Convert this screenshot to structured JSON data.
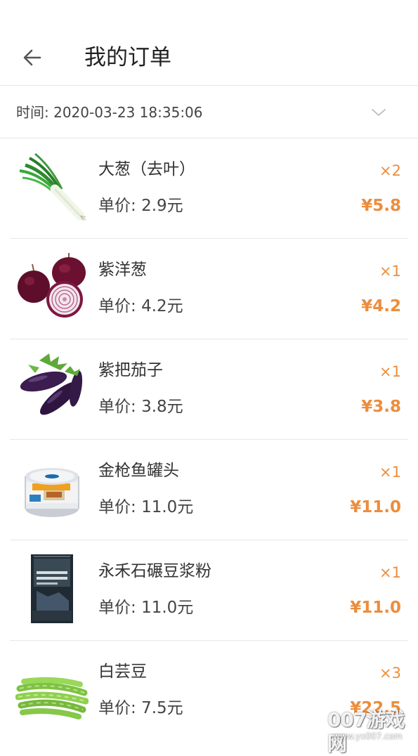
{
  "header": {
    "title": "我的订单",
    "back_icon": "arrow-left-icon"
  },
  "order": {
    "time_text": "时间: 2020-03-23 18:35:06",
    "expand_icon": "chevron-down-icon"
  },
  "price_prefix": "单价:",
  "items": [
    {
      "name": "大葱（去叶）",
      "unit_price": "2.9元",
      "qty": "×2",
      "total": "¥5.8",
      "image": "green-onion"
    },
    {
      "name": "紫洋葱",
      "unit_price": "4.2元",
      "qty": "×1",
      "total": "¥4.2",
      "image": "red-onion"
    },
    {
      "name": "紫把茄子",
      "unit_price": "3.8元",
      "qty": "×1",
      "total": "¥3.8",
      "image": "eggplant"
    },
    {
      "name": "金枪鱼罐头",
      "unit_price": "11.0元",
      "qty": "×1",
      "total": "¥11.0",
      "image": "tuna-can"
    },
    {
      "name": "永禾石碾豆浆粉",
      "unit_price": "11.0元",
      "qty": "×1",
      "total": "¥11.0",
      "image": "soy-milk-powder-bag"
    },
    {
      "name": "白芸豆",
      "unit_price": "7.5元",
      "qty": "×3",
      "total": "¥22.5",
      "image": "green-beans"
    }
  ],
  "watermark": {
    "main": "007游戏网",
    "sub": "www.yx007.com"
  },
  "colors": {
    "accent": "#ec8d3d",
    "divider": "#e6e6e6",
    "text": "#333333"
  }
}
